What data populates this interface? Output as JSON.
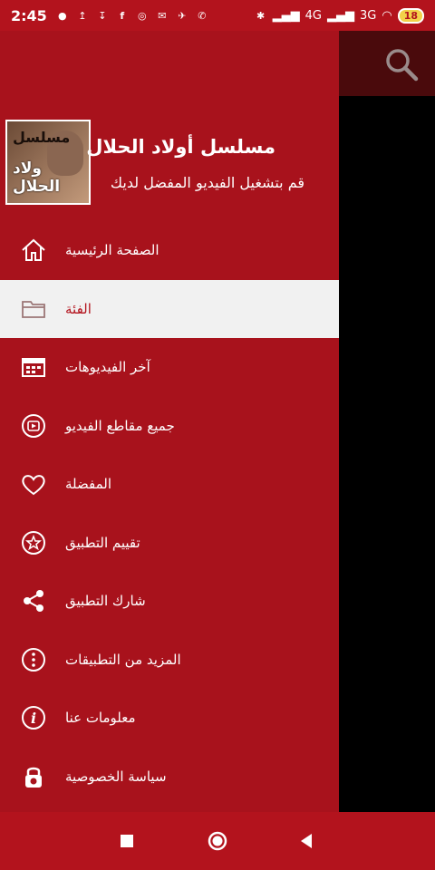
{
  "status": {
    "time": "2:45",
    "network1": "4G",
    "network2": "3G",
    "battery": "18"
  },
  "colors": {
    "drawer": "#a8121c",
    "statusbar": "#b3131d",
    "selected_bg": "#f1f1f1"
  },
  "header": {
    "title": "مسلسل أولاد الحلال",
    "subtitle": "قم بتشغيل الفيديو المفضل لديك",
    "logo_text_top": "مسلسل",
    "logo_text_bottom": "ولاد الحلال"
  },
  "menu": [
    {
      "label": "الصفحة الرئيسية",
      "icon": "home-icon",
      "selected": false
    },
    {
      "label": "الفئة",
      "icon": "folder-icon",
      "selected": true
    },
    {
      "label": "آخر الفيديوهات",
      "icon": "calendar-icon",
      "selected": false
    },
    {
      "label": "جميع مقاطع الفيديو",
      "icon": "play-circle-icon",
      "selected": false
    },
    {
      "label": "المفضلة",
      "icon": "heart-icon",
      "selected": false
    },
    {
      "label": "تقييم التطبيق",
      "icon": "star-circle-icon",
      "selected": false
    },
    {
      "label": "شارك التطبيق",
      "icon": "share-icon",
      "selected": false
    },
    {
      "label": "المزيد من التطبيقات",
      "icon": "more-icon",
      "selected": false
    },
    {
      "label": "معلومات عنا",
      "icon": "info-icon",
      "selected": false
    },
    {
      "label": "سياسة الخصوصية",
      "icon": "lock-icon",
      "selected": false
    }
  ]
}
